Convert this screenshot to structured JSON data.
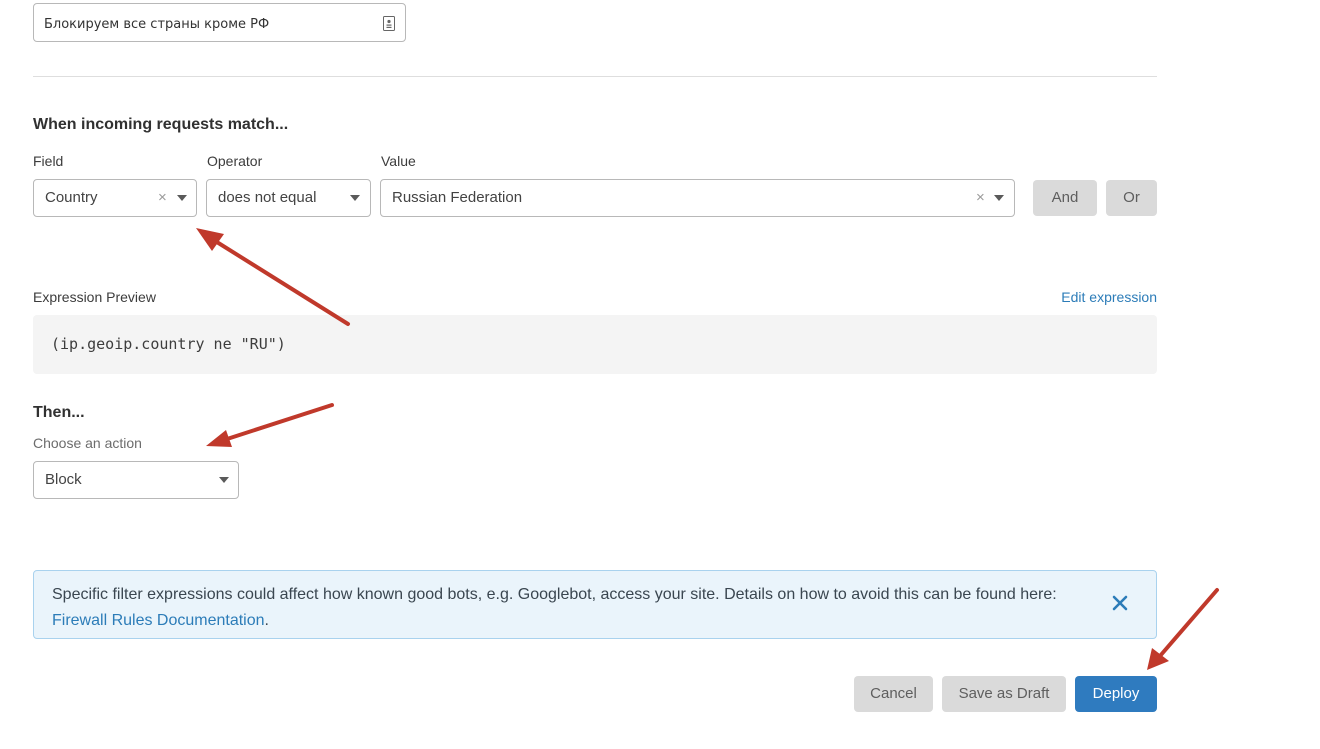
{
  "rule_name": {
    "value": "Блокируем все страны кроме РФ"
  },
  "match": {
    "title": "When incoming requests match...",
    "field_label": "Field",
    "operator_label": "Operator",
    "value_label": "Value",
    "field_value": "Country",
    "operator_value": "does not equal",
    "value_value": "Russian Federation",
    "clear_glyph": "×",
    "and_label": "And",
    "or_label": "Or"
  },
  "expression": {
    "label": "Expression Preview",
    "edit_link": "Edit expression",
    "code": "(ip.geoip.country ne \"RU\")"
  },
  "action": {
    "title": "Then...",
    "label": "Choose an action",
    "value": "Block"
  },
  "notice": {
    "text": "Specific filter expressions could affect how known good bots, e.g. Googlebot, access your site. Details on how to avoid this can be found here: ",
    "link": "Firewall Rules Documentation",
    "suffix": "."
  },
  "footer": {
    "cancel_label": "Cancel",
    "draft_label": "Save as Draft",
    "deploy_label": "Deploy"
  },
  "colors": {
    "primary": "#2f7bbf",
    "link": "#2c7cb8",
    "annotation_arrow": "#c0392b",
    "notice_bg": "#eaf4fb"
  }
}
